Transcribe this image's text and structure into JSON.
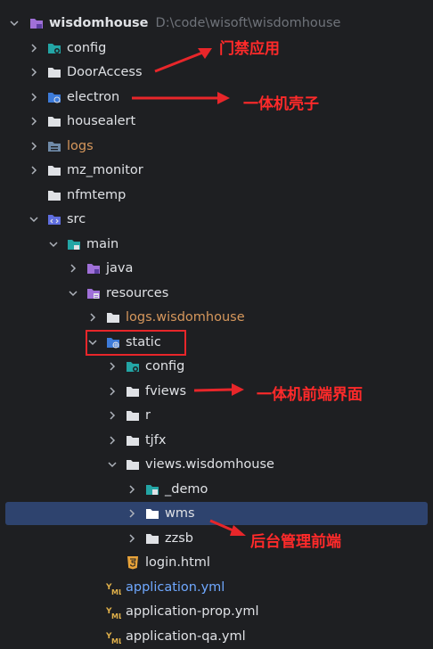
{
  "tree": {
    "root": {
      "label": "wisdomhouse",
      "path": "D:\\code\\wisoft\\wisdomhouse"
    },
    "items": [
      {
        "label": "config"
      },
      {
        "label": "DoorAccess"
      },
      {
        "label": "electron"
      },
      {
        "label": "housealert"
      },
      {
        "label": "logs"
      },
      {
        "label": "mz_monitor"
      },
      {
        "label": "nfmtemp"
      },
      {
        "label": "src"
      },
      {
        "label": "main"
      },
      {
        "label": "java"
      },
      {
        "label": "resources"
      },
      {
        "label": "logs.wisdomhouse"
      },
      {
        "label": "static"
      },
      {
        "label": "config"
      },
      {
        "label": "fviews"
      },
      {
        "label": "r"
      },
      {
        "label": "tjfx"
      },
      {
        "label": "views.wisdomhouse"
      },
      {
        "label": "_demo"
      },
      {
        "label": "wms"
      },
      {
        "label": "zzsb"
      },
      {
        "label": "login.html"
      },
      {
        "label": "application.yml"
      },
      {
        "label": "application-prop.yml"
      },
      {
        "label": "application-qa.yml"
      }
    ]
  },
  "annotations": {
    "door_access": "门禁应用",
    "electron": "一体机壳子",
    "fviews": "一体机前端界面",
    "wms": "后台管理前端"
  },
  "colors": {
    "background": "#1e1f22",
    "selection": "#2e436e",
    "annotation": "#ff2a2a",
    "excluded_folder": "#d6975c",
    "modified_file": "#6fa8ff"
  }
}
